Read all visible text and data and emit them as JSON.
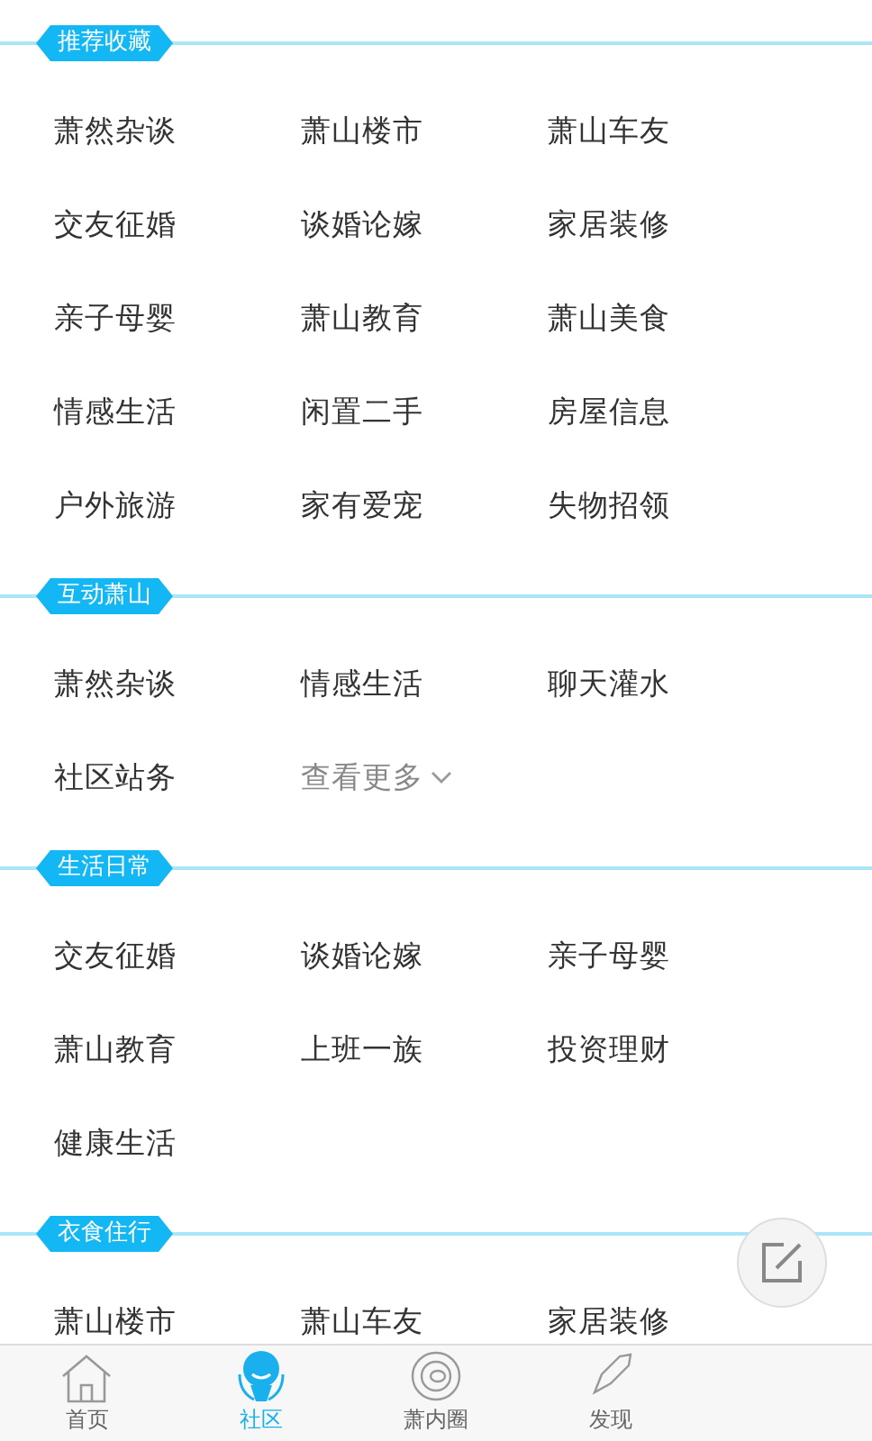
{
  "sections": [
    {
      "title": "推荐收藏",
      "items": [
        {
          "label": "萧然杂谈",
          "kind": "link"
        },
        {
          "label": "萧山楼市",
          "kind": "link"
        },
        {
          "label": "萧山车友",
          "kind": "link"
        },
        {
          "label": "交友征婚",
          "kind": "link"
        },
        {
          "label": "谈婚论嫁",
          "kind": "link"
        },
        {
          "label": "家居装修",
          "kind": "link"
        },
        {
          "label": "亲子母婴",
          "kind": "link"
        },
        {
          "label": "萧山教育",
          "kind": "link"
        },
        {
          "label": "萧山美食",
          "kind": "link"
        },
        {
          "label": "情感生活",
          "kind": "link"
        },
        {
          "label": "闲置二手",
          "kind": "link"
        },
        {
          "label": "房屋信息",
          "kind": "link"
        },
        {
          "label": "户外旅游",
          "kind": "link"
        },
        {
          "label": "家有爱宠",
          "kind": "link"
        },
        {
          "label": "失物招领",
          "kind": "link"
        }
      ]
    },
    {
      "title": "互动萧山",
      "items": [
        {
          "label": "萧然杂谈",
          "kind": "link"
        },
        {
          "label": "情感生活",
          "kind": "link"
        },
        {
          "label": "聊天灌水",
          "kind": "link"
        },
        {
          "label": "社区站务",
          "kind": "link"
        },
        {
          "label": "查看更多",
          "kind": "more"
        }
      ]
    },
    {
      "title": "生活日常",
      "items": [
        {
          "label": "交友征婚",
          "kind": "link"
        },
        {
          "label": "谈婚论嫁",
          "kind": "link"
        },
        {
          "label": "亲子母婴",
          "kind": "link"
        },
        {
          "label": "萧山教育",
          "kind": "link"
        },
        {
          "label": "上班一族",
          "kind": "link"
        },
        {
          "label": "投资理财",
          "kind": "link"
        },
        {
          "label": "健康生活",
          "kind": "link"
        }
      ]
    },
    {
      "title": "衣食住行",
      "items": [
        {
          "label": "萧山楼市",
          "kind": "link"
        },
        {
          "label": "萧山车友",
          "kind": "link"
        },
        {
          "label": "家居装修",
          "kind": "link"
        }
      ]
    }
  ],
  "tabs": [
    {
      "label": "首页",
      "kind": "home",
      "selected": false
    },
    {
      "label": "社区",
      "kind": "community",
      "selected": true
    },
    {
      "label": "萧内圈",
      "kind": "circle",
      "selected": false
    },
    {
      "label": "发现",
      "kind": "discover",
      "selected": false
    }
  ]
}
